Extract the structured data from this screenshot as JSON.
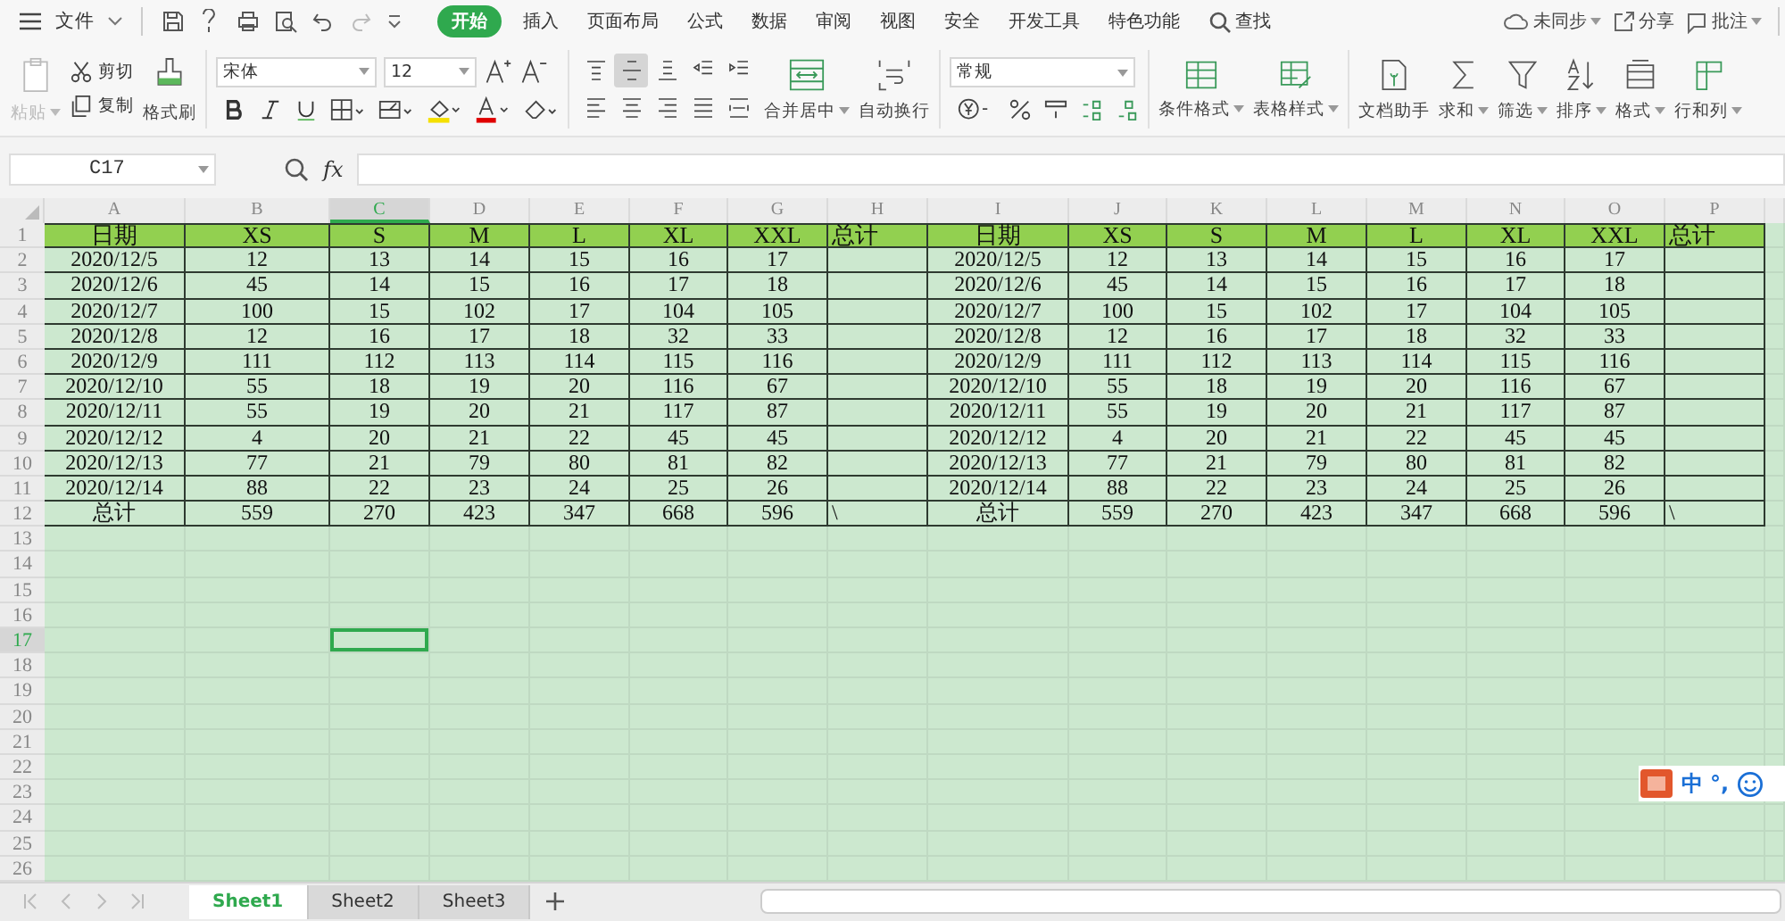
{
  "menu": {
    "file": "文件",
    "tabs": [
      {
        "label": "开始",
        "selected": true
      },
      {
        "label": "插入",
        "selected": false
      },
      {
        "label": "页面布局",
        "selected": false
      },
      {
        "label": "公式",
        "selected": false
      },
      {
        "label": "数据",
        "selected": false
      },
      {
        "label": "审阅",
        "selected": false
      },
      {
        "label": "视图",
        "selected": false
      },
      {
        "label": "安全",
        "selected": false
      },
      {
        "label": "开发工具",
        "selected": false
      },
      {
        "label": "特色功能",
        "selected": false
      }
    ],
    "search": "查找",
    "sync": "未同步",
    "share": "分享",
    "comment": "批注"
  },
  "ribbon": {
    "paste": {
      "label": "粘贴",
      "disabled": true
    },
    "cut": "剪切",
    "copy": "复制",
    "format_painter": "格式刷",
    "font": "宋体",
    "font_size": "12",
    "align_buttons": [
      {
        "kind": "top",
        "selected": false
      },
      {
        "kind": "middle",
        "selected": true
      },
      {
        "kind": "bottom",
        "selected": false
      },
      {
        "kind": "outdent",
        "selected": false
      },
      {
        "kind": "indent",
        "selected": false
      },
      {
        "kind": "left",
        "selected": false
      },
      {
        "kind": "center",
        "selected": false
      },
      {
        "kind": "right",
        "selected": false
      },
      {
        "kind": "justify",
        "selected": false
      },
      {
        "kind": "distributed",
        "selected": false
      }
    ],
    "merge": "合并居中",
    "wrap": "自动换行",
    "number_format": "常规",
    "conditional": "条件格式",
    "table_style": "表格样式",
    "assistant": "文档助手",
    "sum": "求和",
    "filter": "筛选",
    "sort": "排序",
    "format": "格式",
    "rows_cols": "行和列"
  },
  "formula_bar": {
    "name_box": "C17",
    "fx": "fx"
  },
  "sheet": {
    "columns": [
      {
        "label": "A",
        "selected": false
      },
      {
        "label": "B",
        "selected": false
      },
      {
        "label": "C",
        "selected": true
      },
      {
        "label": "D",
        "selected": false
      },
      {
        "label": "E",
        "selected": false
      },
      {
        "label": "F",
        "selected": false
      },
      {
        "label": "G",
        "selected": false
      },
      {
        "label": "H",
        "selected": false
      },
      {
        "label": "I",
        "selected": false
      },
      {
        "label": "J",
        "selected": false
      },
      {
        "label": "K",
        "selected": false
      },
      {
        "label": "L",
        "selected": false
      },
      {
        "label": "M",
        "selected": false
      },
      {
        "label": "N",
        "selected": false
      },
      {
        "label": "O",
        "selected": false
      },
      {
        "label": "P",
        "selected": false
      }
    ],
    "row_headers": [
      {
        "label": "1",
        "selected": false
      },
      {
        "label": "2",
        "selected": false
      },
      {
        "label": "3",
        "selected": false
      },
      {
        "label": "4",
        "selected": false
      },
      {
        "label": "5",
        "selected": false
      },
      {
        "label": "6",
        "selected": false
      },
      {
        "label": "7",
        "selected": false
      },
      {
        "label": "8",
        "selected": false
      },
      {
        "label": "9",
        "selected": false
      },
      {
        "label": "10",
        "selected": false
      },
      {
        "label": "11",
        "selected": false
      },
      {
        "label": "12",
        "selected": false
      },
      {
        "label": "13",
        "selected": false
      },
      {
        "label": "14",
        "selected": false
      },
      {
        "label": "15",
        "selected": false
      },
      {
        "label": "16",
        "selected": false
      },
      {
        "label": "17",
        "selected": true
      },
      {
        "label": "18",
        "selected": false
      },
      {
        "label": "19",
        "selected": false
      },
      {
        "label": "20",
        "selected": false
      },
      {
        "label": "21",
        "selected": false
      },
      {
        "label": "22",
        "selected": false
      },
      {
        "label": "23",
        "selected": false
      },
      {
        "label": "24",
        "selected": false
      },
      {
        "label": "25",
        "selected": false
      },
      {
        "label": "26",
        "selected": false
      }
    ],
    "tables": [
      {
        "header": [
          "日期",
          "XS",
          "S",
          "M",
          "L",
          "XL",
          "XXL",
          "总计"
        ],
        "rows": [
          [
            "2020/12/5",
            "12",
            "13",
            "14",
            "15",
            "16",
            "17"
          ],
          [
            "2020/12/6",
            "45",
            "14",
            "15",
            "16",
            "17",
            "18"
          ],
          [
            "2020/12/7",
            "100",
            "15",
            "102",
            "17",
            "104",
            "105"
          ],
          [
            "2020/12/8",
            "12",
            "16",
            "17",
            "18",
            "32",
            "33"
          ],
          [
            "2020/12/9",
            "111",
            "112",
            "113",
            "114",
            "115",
            "116"
          ],
          [
            "2020/12/10",
            "55",
            "18",
            "19",
            "20",
            "116",
            "67"
          ],
          [
            "2020/12/11",
            "55",
            "19",
            "20",
            "21",
            "117",
            "87"
          ],
          [
            "2020/12/12",
            "4",
            "20",
            "21",
            "22",
            "45",
            "45"
          ],
          [
            "2020/12/13",
            "77",
            "21",
            "79",
            "80",
            "81",
            "82"
          ],
          [
            "2020/12/14",
            "88",
            "22",
            "23",
            "24",
            "25",
            "26"
          ]
        ],
        "total": [
          "总计",
          "559",
          "270",
          "423",
          "347",
          "668",
          "596",
          "\\"
        ]
      },
      {
        "header": [
          "日期",
          "XS",
          "S",
          "M",
          "L",
          "XL",
          "XXL",
          "总计"
        ],
        "rows": [
          [
            "2020/12/5",
            "12",
            "13",
            "14",
            "15",
            "16",
            "17"
          ],
          [
            "2020/12/6",
            "45",
            "14",
            "15",
            "16",
            "17",
            "18"
          ],
          [
            "2020/12/7",
            "100",
            "15",
            "102",
            "17",
            "104",
            "105"
          ],
          [
            "2020/12/8",
            "12",
            "16",
            "17",
            "18",
            "32",
            "33"
          ],
          [
            "2020/12/9",
            "111",
            "112",
            "113",
            "114",
            "115",
            "116"
          ],
          [
            "2020/12/10",
            "55",
            "18",
            "19",
            "20",
            "116",
            "67"
          ],
          [
            "2020/12/11",
            "55",
            "19",
            "20",
            "21",
            "117",
            "87"
          ],
          [
            "2020/12/12",
            "4",
            "20",
            "21",
            "22",
            "45",
            "45"
          ],
          [
            "2020/12/13",
            "77",
            "21",
            "79",
            "80",
            "81",
            "82"
          ],
          [
            "2020/12/14",
            "88",
            "22",
            "23",
            "24",
            "25",
            "26"
          ]
        ],
        "total": [
          "总计",
          "559",
          "270",
          "423",
          "347",
          "668",
          "596",
          "\\"
        ]
      }
    ]
  },
  "sheet_tabs": [
    {
      "label": "Sheet1",
      "selected": true
    },
    {
      "label": "Sheet2",
      "selected": false
    },
    {
      "label": "Sheet3",
      "selected": false
    }
  ],
  "ime": {
    "mode": "中",
    "punctuation": "°,"
  }
}
